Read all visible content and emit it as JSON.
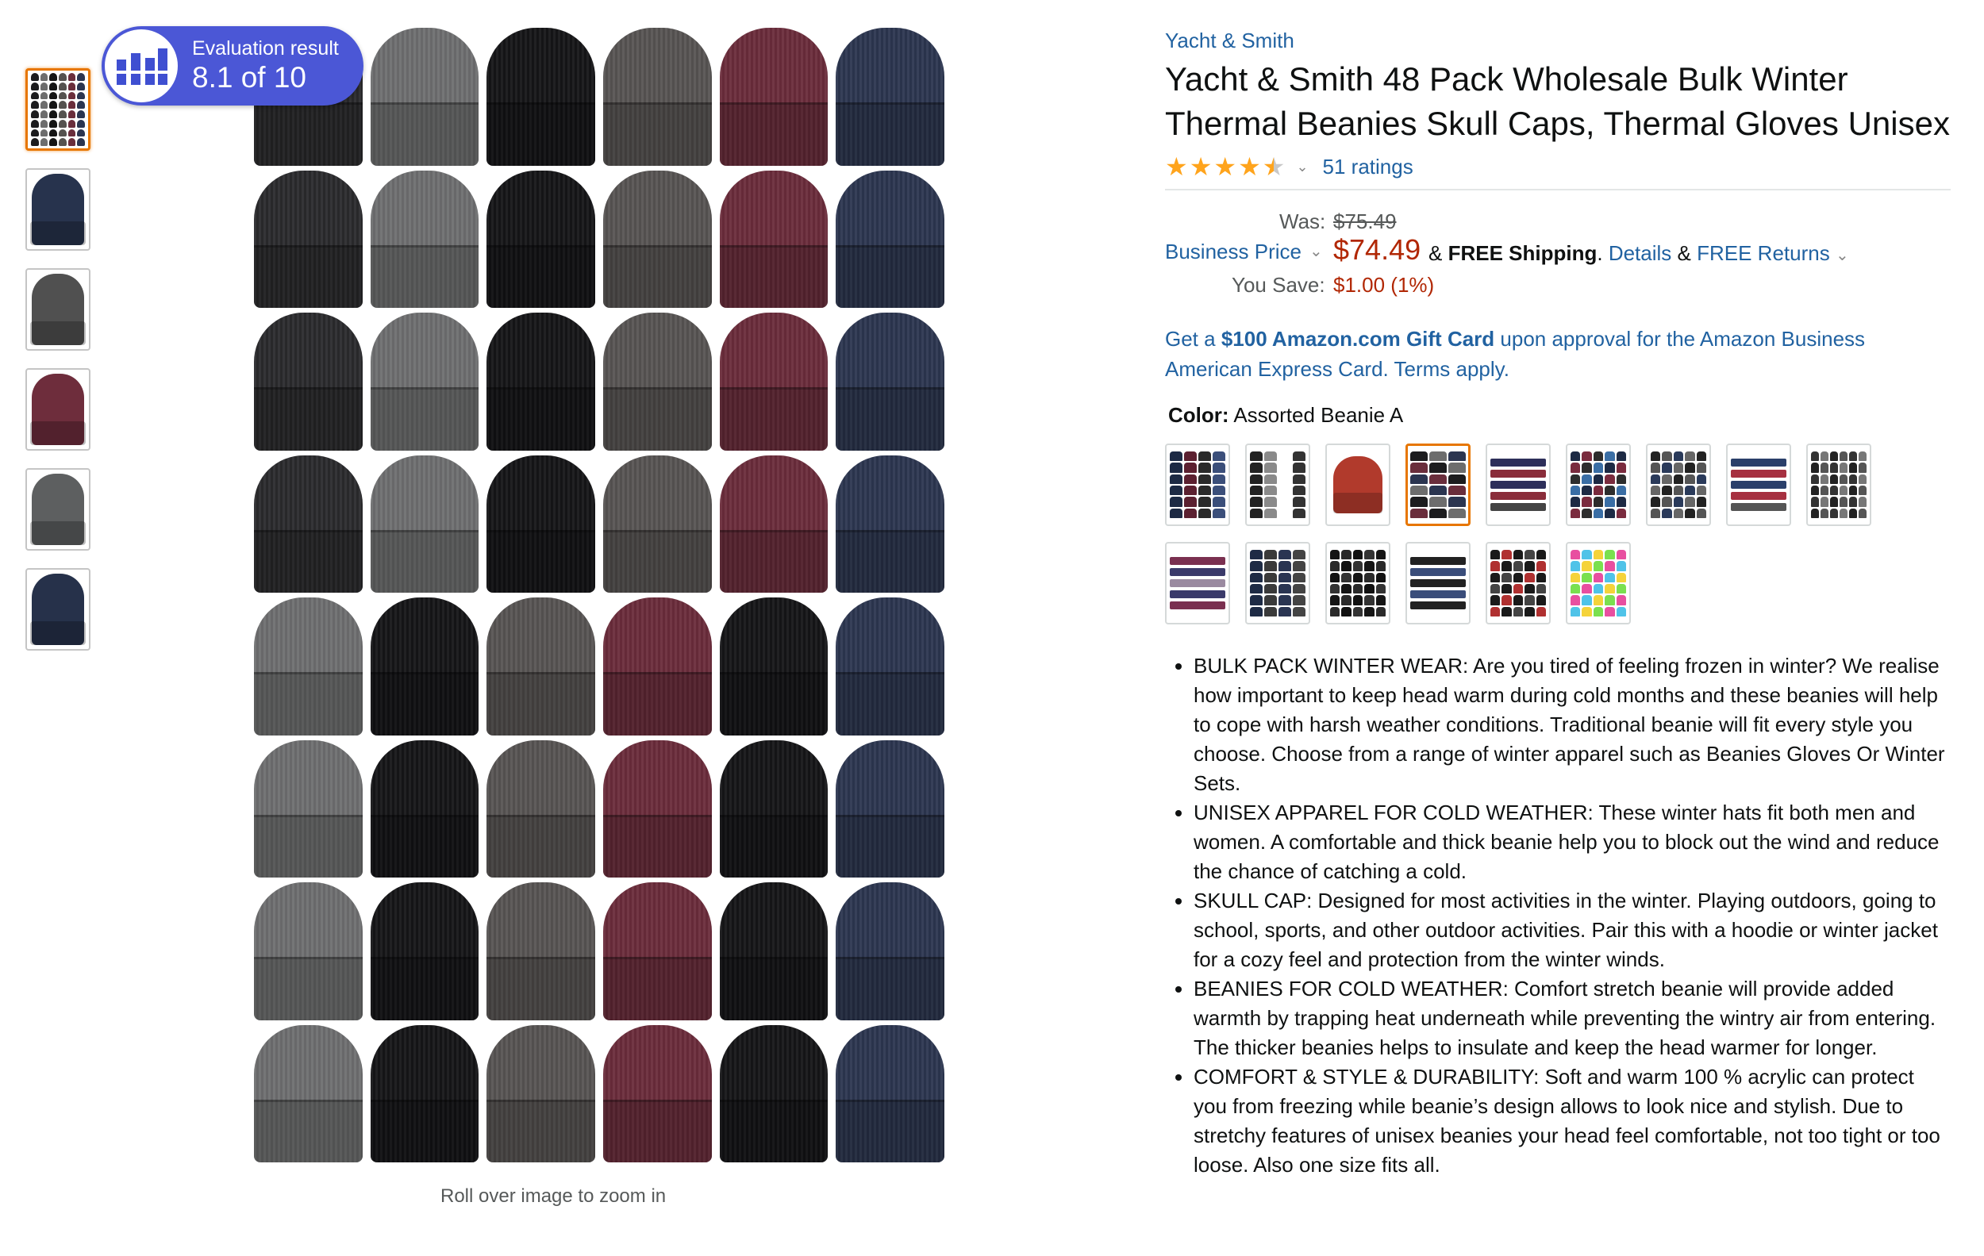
{
  "evaluation": {
    "label": "Evaluation result",
    "score": "8.1 of 10"
  },
  "image": {
    "zoom_hint": "Roll over image to zoom in"
  },
  "thumbnails": [
    {
      "kind": "grid",
      "colors": [
        "#1c1c1e",
        "#6d6d6d",
        "#151515",
        "#55524f",
        "#6a2e3c",
        "#2b3550"
      ]
    },
    {
      "kind": "hat",
      "color": "#27334d"
    },
    {
      "kind": "hat",
      "color": "#505050"
    },
    {
      "kind": "hat",
      "color": "#6e2d3c"
    },
    {
      "kind": "hat",
      "color": "#5d5f60"
    },
    {
      "kind": "hat",
      "color": "#26314a"
    }
  ],
  "hat_colors": {
    "charcoal": "#2a2a2d",
    "grey": "#6e6f70",
    "black": "#151517",
    "darkgrey": "#575453",
    "burgundy": "#6b2c3b",
    "navy": "#2c3650"
  },
  "hat_rows": [
    [
      "charcoal",
      "grey",
      "black",
      "darkgrey",
      "burgundy",
      "navy"
    ],
    [
      "charcoal",
      "grey",
      "black",
      "darkgrey",
      "burgundy",
      "navy"
    ],
    [
      "charcoal",
      "grey",
      "black",
      "darkgrey",
      "burgundy",
      "navy"
    ],
    [
      "charcoal",
      "grey",
      "black",
      "darkgrey",
      "burgundy",
      "navy"
    ],
    [
      "grey",
      "black",
      "darkgrey",
      "burgundy",
      "black",
      "navy"
    ],
    [
      "grey",
      "black",
      "darkgrey",
      "burgundy",
      "black",
      "navy"
    ],
    [
      "grey",
      "black",
      "darkgrey",
      "burgundy",
      "black",
      "navy"
    ],
    [
      "grey",
      "black",
      "darkgrey",
      "burgundy",
      "black",
      "navy"
    ]
  ],
  "product": {
    "brand": "Yacht & Smith",
    "title": "Yacht & Smith 48 Pack Wholesale Bulk Winter Thermal Beanies Skull Caps, Thermal Gloves Unisex",
    "rating_stars": 4.5,
    "ratings_count": "51 ratings"
  },
  "price": {
    "was_label": "Was:",
    "was_value": "$75.49",
    "business_label": "Business Price",
    "current": "$74.49",
    "ampersand": "&",
    "free_shipping": "FREE Shipping",
    "period": ".",
    "details": "Details",
    "free_returns": "FREE Returns",
    "save_label": "You Save:",
    "save_value": "$1.00 (1%)"
  },
  "gift": {
    "prefix": "Get a ",
    "amount": "$100 Amazon.com Gift Card",
    "suffix": " upon approval for the Amazon Business American Express Card. Terms apply."
  },
  "color": {
    "label": "Color:",
    "value": "Assorted Beanie A",
    "selected_index": 3,
    "swatches": [
      {
        "kind": "grid",
        "cols": 4,
        "colors": [
          "#1d2a44",
          "#5b2030",
          "#2a2a2a",
          "#3b4f7a"
        ]
      },
      {
        "kind": "grid",
        "cols": 4,
        "colors": [
          "#222222",
          "#8a8a8a",
          "#ffffff",
          "#333333"
        ]
      },
      {
        "kind": "hat"
      },
      {
        "kind": "grid",
        "cols": 3,
        "colors": [
          "#1c1c1e",
          "#6d6d6d",
          "#2b3550",
          "#6a2e3c"
        ]
      },
      {
        "kind": "stripes",
        "colors": [
          "#2d2f5a",
          "#8a2d3a",
          "#2d2f5a",
          "#8a2d3a",
          "#444"
        ]
      },
      {
        "kind": "grid",
        "cols": 5,
        "colors": [
          "#1d2a44",
          "#7a2b3e",
          "#2d2d2d",
          "#3a6ea5"
        ]
      },
      {
        "kind": "grid",
        "cols": 5,
        "colors": [
          "#222",
          "#555",
          "#2a3a5a",
          "#666"
        ]
      },
      {
        "kind": "stripes",
        "colors": [
          "#2a3f6a",
          "#a63040",
          "#2a3f6a",
          "#a63040",
          "#555"
        ]
      },
      {
        "kind": "grid",
        "cols": 6,
        "colors": [
          "#333",
          "#777",
          "#222",
          "#555"
        ]
      },
      {
        "kind": "stripes",
        "colors": [
          "#7a3050",
          "#3a3a6a",
          "#9a8aa0",
          "#3a3a6a",
          "#7a3050"
        ]
      },
      {
        "kind": "grid",
        "cols": 4,
        "colors": [
          "#1e2b45",
          "#3a3a3a",
          "#2a3552",
          "#444"
        ]
      },
      {
        "kind": "grid",
        "cols": 5,
        "colors": [
          "#151515",
          "#2a2a2a",
          "#111",
          "#333"
        ]
      },
      {
        "kind": "stripes",
        "colors": [
          "#222",
          "#3a4d7a",
          "#222",
          "#3a4d7a",
          "#222"
        ]
      },
      {
        "kind": "grid",
        "cols": 5,
        "colors": [
          "#1a1a1a",
          "#b03030",
          "#1a1a1a",
          "#444"
        ]
      },
      {
        "kind": "grid",
        "cols": 5,
        "colors": [
          "#e84fa0",
          "#4fc3e8",
          "#f5d33a",
          "#7ae04f"
        ]
      }
    ]
  },
  "bullets": [
    "BULK PACK WINTER WEAR: Are you tired of feeling frozen in winter? We realise how important to keep head warm during cold months and these beanies will help to cope with harsh weather conditions. Traditional beanie will fit every style you choose. Choose from a range of winter apparel such as Beanies Gloves Or Winter Sets.",
    "UNISEX APPAREL FOR COLD WEATHER: These winter hats fit both men and women. A comfortable and thick beanie help you to block out the wind and reduce the chance of catching a cold.",
    "SKULL CAP: Designed for most activities in the winter. Playing outdoors, going to school, sports, and other outdoor activities. Pair this with a hoodie or winter jacket for a cozy feel and protection from the winter winds.",
    "BEANIES FOR COLD WEATHER: Comfort stretch beanie will provide added warmth by trapping heat underneath while preventing the wintry air from entering. The thicker beanies helps to insulate and keep the head warmer for longer.",
    "COMFORT & STYLE & DURABILITY: Soft and warm 100 % acrylic can protect you from freezing while beanie’s design allows to look nice and stylish. Due to stretchy features of unisex beanies your head feel comfortable, not too tight or too loose. Also one size fits all."
  ]
}
